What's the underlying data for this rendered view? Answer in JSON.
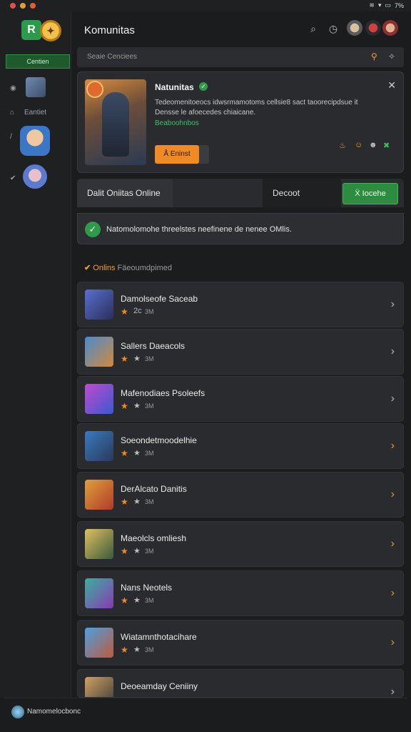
{
  "status_bar": {
    "signal": "▾",
    "battery": "7%"
  },
  "sidebar": {
    "active_label": "Centien",
    "item_label": "Eantiet"
  },
  "header": {
    "title": "Komunitas"
  },
  "search": {
    "placeholder": "Seaie Cenciees"
  },
  "featured": {
    "title": "Natunitas",
    "description": "Tedeomenitoeocs idwsrmamotoms cellsie8 sact taoorecipdsue it Densse le afoecedes chiaicane.",
    "link": "Beaboohnbos",
    "button": "Å Eninst"
  },
  "tabs": {
    "active": "Dalit Oniitas Online",
    "second": "Decoot",
    "cta": "Ẍ Iocehe"
  },
  "notice": {
    "text": "Natomolomohe threelstes neefinene de nenee OMlis."
  },
  "section": {
    "check": "✔",
    "title": "Onlins",
    "subtitle": "Fäeoumdpimed"
  },
  "games": [
    {
      "title": "Damolseofe Saceab",
      "rating_text": "2c",
      "count": "3M",
      "chevron_color": "#bbbbbb"
    },
    {
      "title": "Sallers Daeacols",
      "rating_text": "★",
      "count": "3M",
      "chevron_color": "#bbbbbb"
    },
    {
      "title": "Mafenodiaes Psoleefs",
      "rating_text": "★",
      "count": "3M",
      "chevron_color": "#bbbbbb"
    },
    {
      "title": "Soeondetmoodelhie",
      "rating_text": "★",
      "count": "3M",
      "chevron_color": "#e09a3a"
    },
    {
      "title": "DerAlcato Danitis",
      "rating_text": "★",
      "count": "3M",
      "chevron_color": "#e09a3a"
    },
    {
      "title": "Maeolcls omliesh",
      "rating_text": "★",
      "count": "3M",
      "chevron_color": "#e09a3a"
    },
    {
      "title": "Nans Neotels",
      "rating_text": "★",
      "count": "3M",
      "chevron_color": "#e09a3a"
    },
    {
      "title": "Wiatamnthotacihare",
      "rating_text": "★",
      "count": "3M",
      "chevron_color": "#e09a3a"
    },
    {
      "title": "Deoeamday Ceniiny",
      "rating_text": "",
      "count": "",
      "chevron_color": "#bbbbbb"
    }
  ],
  "bottom": {
    "text": "Namomelocbonc"
  }
}
